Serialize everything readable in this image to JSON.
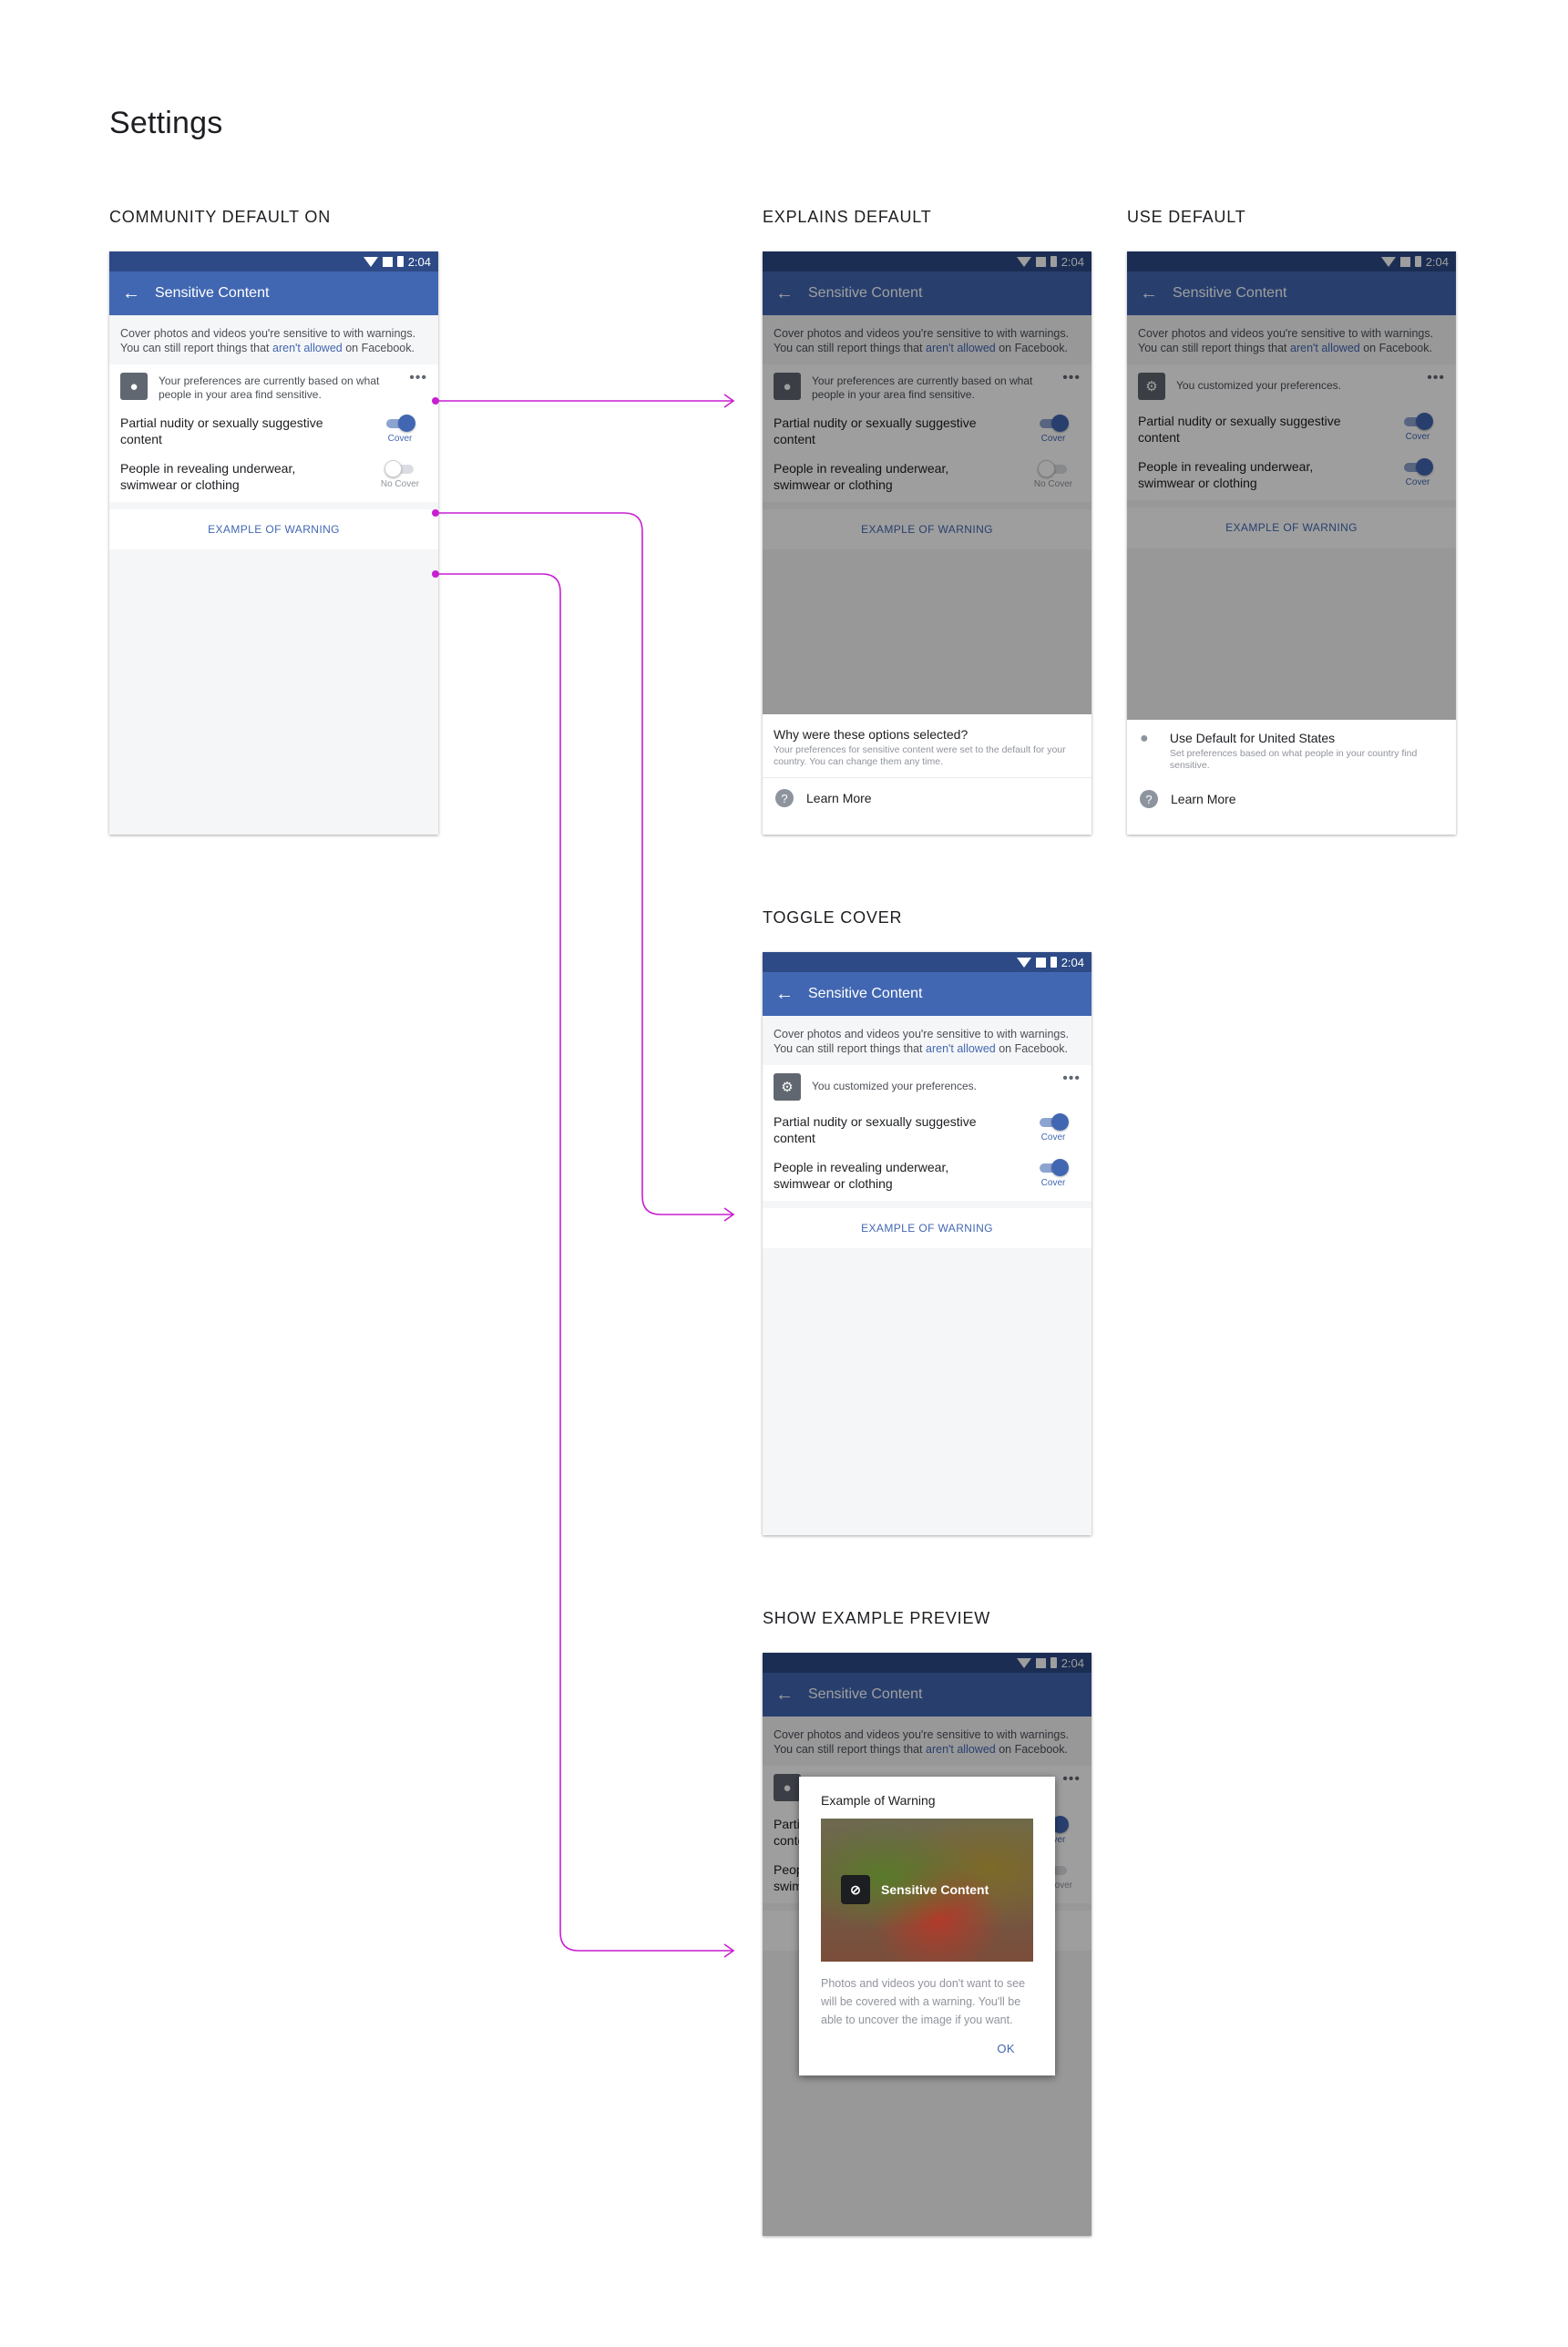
{
  "page_title": "Settings",
  "sections": {
    "community_default_on": "COMMUNITY DEFAULT ON",
    "explains_default": "EXPLAINS DEFAULT",
    "use_default": "USE DEFAULT",
    "toggle_cover": "TOGGLE COVER",
    "show_example_preview": "SHOW EXAMPLE PREVIEW"
  },
  "status_time": "2:04",
  "screen_title": "Sensitive Content",
  "intro": {
    "text_before": "Cover photos and videos you're sensitive to with warnings. You can still report things that ",
    "link": "aren't allowed",
    "text_after": " on Facebook."
  },
  "pref_default_text": "Your preferences are currently based on what people in your area find sensitive.",
  "pref_custom_text": "You customized your preferences.",
  "more_label": "•••",
  "toggle1_label": "Partial nudity or sexually suggestive content",
  "toggle2_label": "People in revealing underwear, swimwear or clothing",
  "status_cover": "Cover",
  "status_no_cover": "No Cover",
  "example_button": "EXAMPLE OF WARNING",
  "explain_sheet": {
    "title": "Why were these options selected?",
    "sub": "Your preferences for sensitive content were set to the default for your country. You can change them any time.",
    "learn_more": "Learn More"
  },
  "default_sheet": {
    "title": "Use Default for United States",
    "sub": "Set preferences based on what people in your country find sensitive.",
    "learn_more": "Learn More"
  },
  "dialog": {
    "title": "Example of Warning",
    "preview_label": "Sensitive Content",
    "body": "Photos and videos you don't want to see will be covered with a warning. You'll be able to uncover the image if you want.",
    "ok": "OK"
  },
  "colors": {
    "fb_blue": "#4267b2",
    "status_bar": "#2d4a86",
    "connector": "#c81fd1"
  },
  "toggles": {
    "community_default_on": [
      "on",
      "off"
    ],
    "explains_default": [
      "on",
      "off"
    ],
    "use_default": [
      "on",
      "on"
    ],
    "toggle_cover": [
      "on",
      "on"
    ],
    "show_example_preview": [
      "on",
      "off"
    ]
  }
}
